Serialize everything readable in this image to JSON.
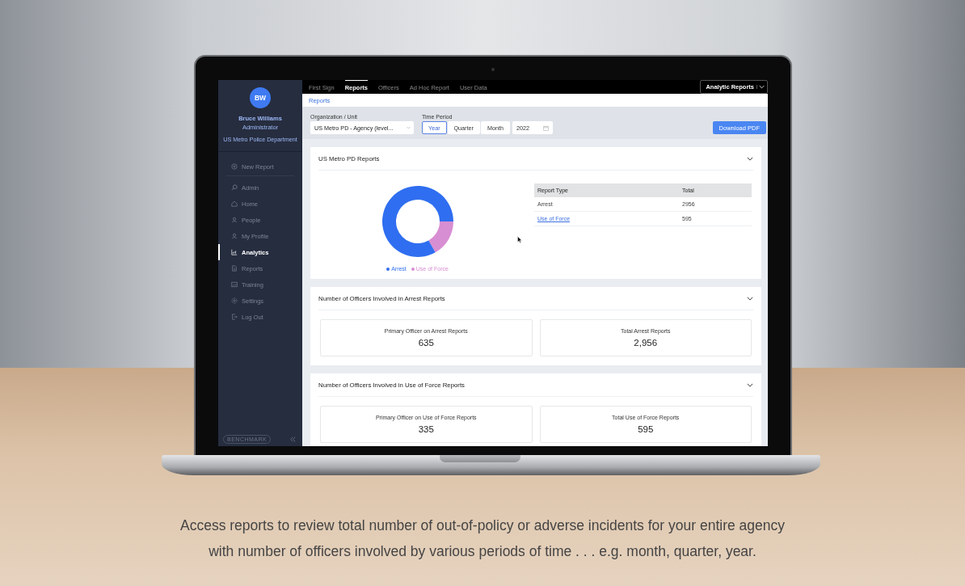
{
  "sidebar": {
    "avatar": "BW",
    "user_name": "Bruce Williams",
    "role": "Administrator",
    "organization": "US Metro Police Department",
    "items": [
      {
        "label": "New Report",
        "kind": "action",
        "selected": false
      },
      {
        "label": "Admin",
        "kind": "nav",
        "selected": false
      },
      {
        "label": "Home",
        "kind": "nav",
        "selected": false
      },
      {
        "label": "People",
        "kind": "nav",
        "selected": false
      },
      {
        "label": "My Profile",
        "kind": "nav",
        "selected": false
      },
      {
        "label": "Analytics",
        "kind": "nav",
        "selected": true
      },
      {
        "label": "Reports",
        "kind": "nav",
        "selected": false
      },
      {
        "label": "Training",
        "kind": "nav",
        "selected": false
      },
      {
        "label": "Settings",
        "kind": "nav",
        "selected": false
      },
      {
        "label": "Log Out",
        "kind": "nav",
        "selected": false
      }
    ],
    "brand": "BENCHMARK"
  },
  "tabs": [
    {
      "label": "First Sign",
      "selected": false
    },
    {
      "label": "Reports",
      "selected": true
    },
    {
      "label": "Officers",
      "selected": false
    },
    {
      "label": "Ad Hoc Report",
      "selected": false
    },
    {
      "label": "User Data",
      "selected": false
    }
  ],
  "view_menu": {
    "value": "Analytic Reports"
  },
  "breadcrumb": "Reports",
  "filters": {
    "organization_label": "Organization / Unit",
    "organization": "US Metro PD - Agency (level...",
    "time_period_label": "Time Period",
    "periods": [
      {
        "label": "Year",
        "selected": true
      },
      {
        "label": "Quarter",
        "selected": false
      },
      {
        "label": "Month",
        "selected": false
      }
    ],
    "year": "2022",
    "download": "Download PDF"
  },
  "reports_card": {
    "title": "US Metro PD Reports",
    "legend": [
      {
        "color": "#2f6ef0"
      },
      {
        "color": "#d88ed2"
      }
    ],
    "chart_data": {
      "type": "donut",
      "categories": [
        "Arrest",
        "Use of Force"
      ],
      "values": [
        83.2,
        16.8
      ]
    },
    "table": {
      "columns": [
        "Report Type",
        "Total"
      ],
      "rows": [
        {
          "type": "Arrest",
          "total": "2956",
          "link": false
        },
        {
          "type": "Use of Force",
          "total": "595",
          "link": true
        }
      ]
    }
  },
  "stat_cards": [
    {
      "title": "Number of Officers Involved in Arrest Reports",
      "stats": [
        {
          "label": "Primary Officer on Arrest Reports",
          "value": "635"
        },
        {
          "label": "Total Arrest Reports",
          "value": "2,956"
        }
      ]
    },
    {
      "title": "Number of Officers Involved in Use of Force Reports",
      "stats": [
        {
          "label": "Primary Officer on Use of Force Reports",
          "value": "335"
        },
        {
          "label": "Total Use of Force Reports",
          "value": "595"
        }
      ]
    }
  ],
  "caption": "Access reports to review total number of out-of-policy or adverse incidents for your entire agency with number of officers involved by various periods of time . . . e.g. month, quarter, year."
}
